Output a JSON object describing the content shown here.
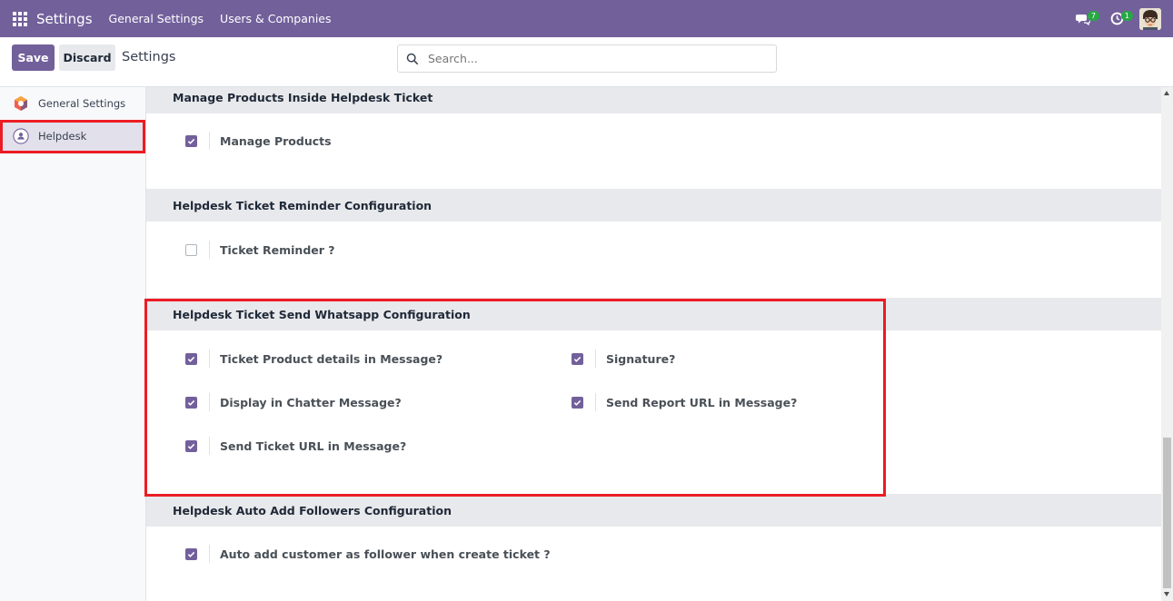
{
  "navbar": {
    "brand": "Settings",
    "menu": [
      "General Settings",
      "Users & Companies"
    ],
    "messages_badge": "7",
    "activities_badge": "1",
    "color": "#72609b"
  },
  "control": {
    "save_label": "Save",
    "discard_label": "Discard",
    "breadcrumb": "Settings",
    "search_placeholder": "Search..."
  },
  "sidebar": {
    "items": [
      {
        "label": "General Settings",
        "icon": "odoo-logo-icon",
        "active": false
      },
      {
        "label": "Helpdesk",
        "icon": "helpdesk-icon",
        "active": true
      }
    ]
  },
  "sections": [
    {
      "title": "Manage Products Inside Helpdesk Ticket",
      "settings": [
        {
          "label": "Manage Products",
          "checked": true
        }
      ]
    },
    {
      "title": "Helpdesk Ticket Reminder Configuration",
      "settings": [
        {
          "label": "Ticket Reminder ?",
          "checked": false
        }
      ]
    },
    {
      "title": "Helpdesk Ticket Send Whatsapp Configuration",
      "settings": [
        {
          "label": "Ticket Product details in Message?",
          "checked": true
        },
        {
          "label": "Signature?",
          "checked": true
        },
        {
          "label": "Display in Chatter Message?",
          "checked": true
        },
        {
          "label": "Send Report URL in Message?",
          "checked": true
        },
        {
          "label": "Send Ticket URL in Message?",
          "checked": true
        }
      ]
    },
    {
      "title": "Helpdesk Auto Add Followers Configuration",
      "settings": [
        {
          "label": "Auto add customer as follower when create ticket ?",
          "checked": true
        }
      ]
    }
  ],
  "colors": {
    "accent": "#72609b",
    "highlight": "#ec1c24"
  }
}
